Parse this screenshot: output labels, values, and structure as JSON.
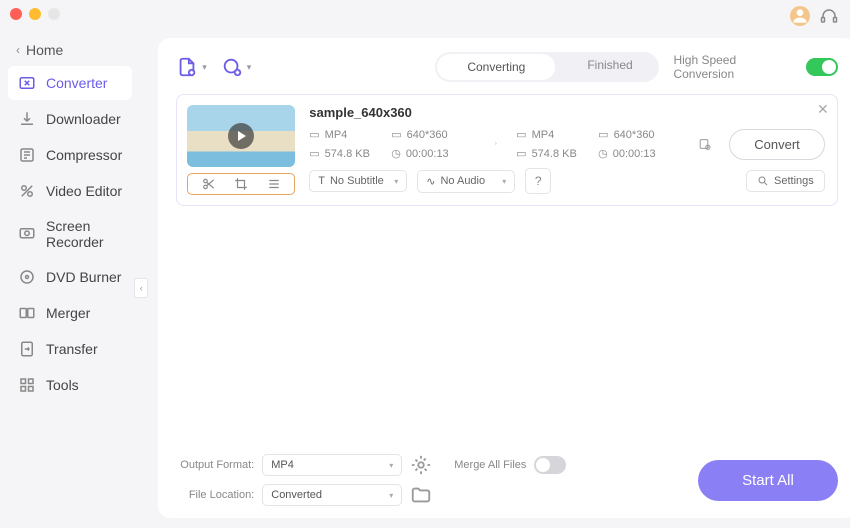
{
  "home_label": "Home",
  "sidebar": {
    "items": [
      {
        "label": "Converter",
        "icon": "converter-icon",
        "active": true
      },
      {
        "label": "Downloader",
        "icon": "downloader-icon"
      },
      {
        "label": "Compressor",
        "icon": "compressor-icon"
      },
      {
        "label": "Video Editor",
        "icon": "editor-icon"
      },
      {
        "label": "Screen Recorder",
        "icon": "recorder-icon"
      },
      {
        "label": "DVD Burner",
        "icon": "dvd-icon"
      },
      {
        "label": "Merger",
        "icon": "merger-icon"
      },
      {
        "label": "Transfer",
        "icon": "transfer-icon"
      },
      {
        "label": "Tools",
        "icon": "tools-icon"
      }
    ]
  },
  "tabs": {
    "converting": "Converting",
    "finished": "Finished",
    "active": "converting"
  },
  "hsc_label": "High Speed Conversion",
  "hsc_on": true,
  "file": {
    "title": "sample_640x360",
    "src": {
      "format": "MP4",
      "resolution": "640*360",
      "size": "574.8 KB",
      "duration": "00:00:13"
    },
    "dst": {
      "format": "MP4",
      "resolution": "640*360",
      "size": "574.8 KB",
      "duration": "00:00:13"
    },
    "subtitle": "No Subtitle",
    "audio": "No Audio",
    "settings_label": "Settings",
    "convert_label": "Convert"
  },
  "footer": {
    "output_format_label": "Output Format:",
    "output_format_value": "MP4",
    "file_location_label": "File Location:",
    "file_location_value": "Converted",
    "merge_label": "Merge All Files",
    "merge_on": false,
    "start_all_label": "Start All"
  },
  "colors": {
    "accent": "#8b7ff5",
    "highlight_border": "#e7a45c"
  }
}
